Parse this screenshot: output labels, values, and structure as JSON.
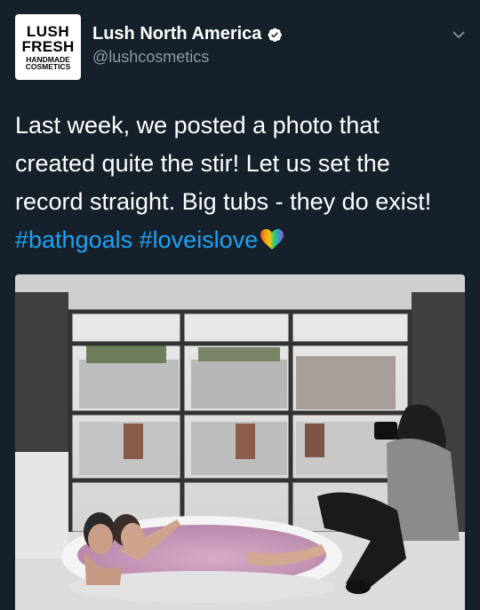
{
  "tweet": {
    "avatar_text": [
      "LUSH",
      "FRESH",
      "HANDMADE",
      "COSMETICS"
    ],
    "display_name": "Lush North America",
    "handle": "@lushcosmetics",
    "verified": true,
    "body_line1": "Last week, we posted a photo that",
    "body_line2": "created quite the stir! Let us set the",
    "body_line3": "record straight. Big tubs - they do exist!",
    "hashtag1": "#bathgoals",
    "hashtag2": "#loveislove",
    "emoji": "rainbow-heart-icon"
  },
  "colors": {
    "background": "#15202b",
    "text": "#ffffff",
    "secondary_text": "#8899a6",
    "link": "#1da1f2"
  }
}
